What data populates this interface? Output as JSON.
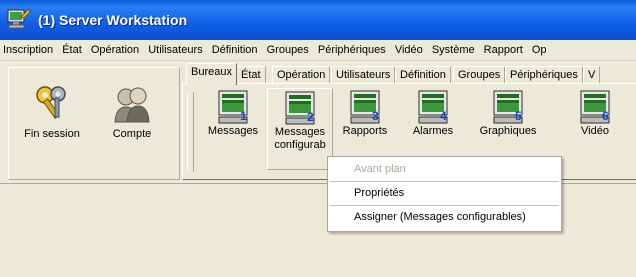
{
  "window": {
    "title": "(1)  Server Workstation"
  },
  "menubar": [
    "Inscription",
    "État",
    "Opération",
    "Utilisateurs",
    "Définition",
    "Groupes",
    "Périphériques",
    "Vidéo",
    "Système",
    "Rapport",
    "Op"
  ],
  "session": {
    "logout_label": "Fin session",
    "account_label": "Compte"
  },
  "tabs": [
    {
      "label": "Bureaux",
      "active": true
    },
    {
      "label": "État"
    },
    {
      "label": "Opération"
    },
    {
      "label": "Utilisateurs"
    },
    {
      "label": "Définition"
    },
    {
      "label": "Groupes"
    },
    {
      "label": "Périphériques"
    },
    {
      "label": "V"
    }
  ],
  "desktops": [
    {
      "label": "Messages",
      "number": "1",
      "icon": "monitor-icon"
    },
    {
      "label": "Messages configurab",
      "number": "2",
      "icon": "monitor-icon"
    },
    {
      "label": "Rapports",
      "number": "3",
      "icon": "monitor-icon"
    },
    {
      "label": "Alarmes",
      "number": "4",
      "icon": "monitor-icon"
    },
    {
      "label": "Graphiques",
      "number": "5",
      "icon": "monitor-icon"
    },
    {
      "label": "Vidéo",
      "number": "6",
      "icon": "monitor-icon"
    }
  ],
  "context_menu": {
    "bring_to_front": "Avant plan",
    "properties": "Propriétés",
    "assign": "Assigner  (Messages configurables)"
  },
  "colors": {
    "titlebar": "#0c4fd2",
    "face": "#ece9d8",
    "disabled_text": "#aca899",
    "monitor_green": "#2f8f2f",
    "monitor_number": "#1144cc"
  }
}
